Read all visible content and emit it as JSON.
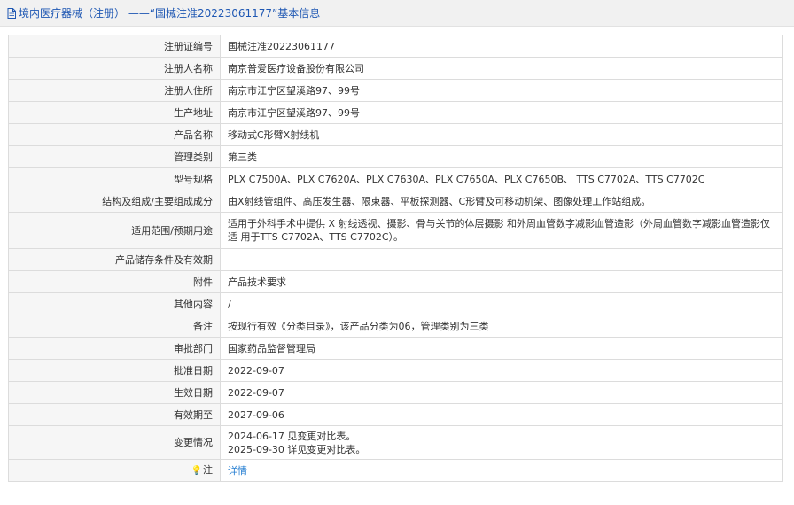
{
  "header": {
    "title": "境内医疗器械（注册） ——“国械注准20223061177”基本信息"
  },
  "rows": [
    {
      "label": "注册证编号",
      "value": "国械注准20223061177"
    },
    {
      "label": "注册人名称",
      "value": "南京普爱医疗设备股份有限公司"
    },
    {
      "label": "注册人住所",
      "value": "南京市江宁区望溪路97、99号"
    },
    {
      "label": "生产地址",
      "value": "南京市江宁区望溪路97、99号"
    },
    {
      "label": "产品名称",
      "value": "移动式C形臂X射线机"
    },
    {
      "label": "管理类别",
      "value": "第三类"
    },
    {
      "label": "型号规格",
      "value": "PLX C7500A、PLX C7620A、PLX C7630A、PLX C7650A、PLX C7650B、 TTS C7702A、TTS C7702C"
    },
    {
      "label": "结构及组成/主要组成成分",
      "value": "由X射线管组件、高压发生器、限束器、平板探测器、C形臂及可移动机架、图像处理工作站组成。"
    },
    {
      "label": "适用范围/预期用途",
      "value": "适用于外科手术中提供 X 射线透视、摄影、骨与关节的体层摄影 和外周血管数字减影血管造影（外周血管数字减影血管造影仅适 用于TTS C7702A、TTS C7702C）。"
    },
    {
      "label": "产品储存条件及有效期",
      "value": ""
    },
    {
      "label": "附件",
      "value": "产品技术要求"
    },
    {
      "label": "其他内容",
      "value": "/"
    },
    {
      "label": "备注",
      "value": "按现行有效《分类目录》，该产品分类为06，管理类别为三类"
    },
    {
      "label": "审批部门",
      "value": "国家药品监督管理局"
    },
    {
      "label": "批准日期",
      "value": "2022-09-07"
    },
    {
      "label": "生效日期",
      "value": "2022-09-07"
    },
    {
      "label": "有效期至",
      "value": "2027-09-06"
    },
    {
      "label": "变更情况",
      "value_lines": [
        "2024-06-17 见变更对比表。",
        "2025-09-30 详见变更对比表。"
      ]
    },
    {
      "label": "注",
      "icon": "lightbulb-icon",
      "value": "详情"
    }
  ]
}
